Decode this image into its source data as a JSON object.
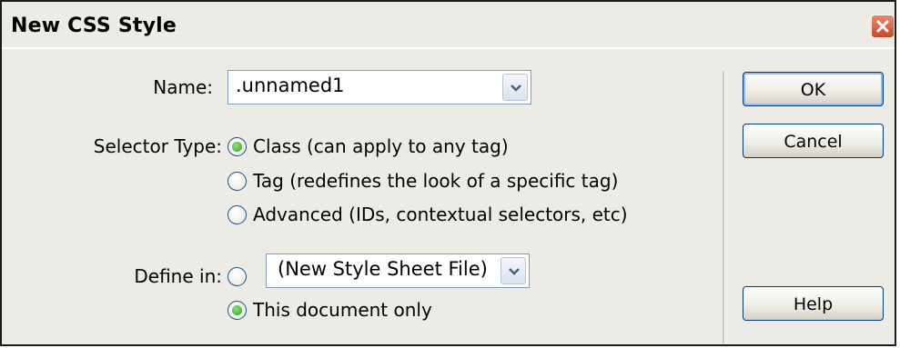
{
  "window": {
    "title": "New CSS Style"
  },
  "name": {
    "label": "Name:",
    "value": ".unnamed1"
  },
  "selector": {
    "label": "Selector Type:",
    "options": [
      {
        "label": "Class (can apply to any tag)",
        "checked": true
      },
      {
        "label": "Tag (redefines the look of a specific tag)",
        "checked": false
      },
      {
        "label": "Advanced (IDs, contextual selectors, etc)",
        "checked": false
      }
    ]
  },
  "define_in": {
    "label": "Define in:",
    "file_select_value": "(New Style Sheet File)",
    "file_option_checked": false,
    "this_doc_label": "This document only",
    "this_doc_checked": true
  },
  "buttons": {
    "ok": "OK",
    "cancel": "Cancel",
    "help": "Help"
  },
  "colors": {
    "radio_selected": "#2aa21a",
    "close_button": "#c9472a",
    "dialog_bg": "#ecebe6"
  },
  "icons": {
    "close": "close-icon",
    "dropdown": "chevron-down-icon"
  }
}
